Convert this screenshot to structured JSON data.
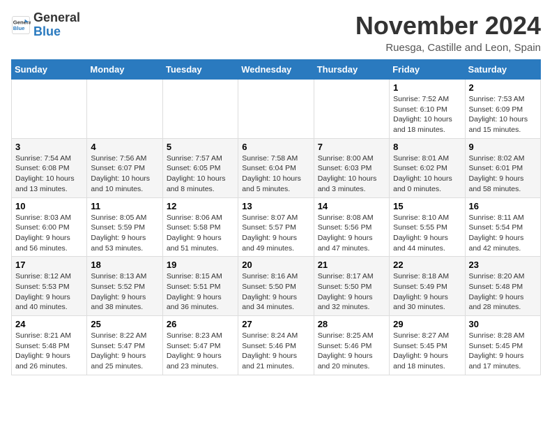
{
  "logo": {
    "line1": "General",
    "line2": "Blue"
  },
  "title": "November 2024",
  "subtitle": "Ruesga, Castille and Leon, Spain",
  "days_of_week": [
    "Sunday",
    "Monday",
    "Tuesday",
    "Wednesday",
    "Thursday",
    "Friday",
    "Saturday"
  ],
  "weeks": [
    [
      {
        "day": "",
        "info": ""
      },
      {
        "day": "",
        "info": ""
      },
      {
        "day": "",
        "info": ""
      },
      {
        "day": "",
        "info": ""
      },
      {
        "day": "",
        "info": ""
      },
      {
        "day": "1",
        "info": "Sunrise: 7:52 AM\nSunset: 6:10 PM\nDaylight: 10 hours and 18 minutes."
      },
      {
        "day": "2",
        "info": "Sunrise: 7:53 AM\nSunset: 6:09 PM\nDaylight: 10 hours and 15 minutes."
      }
    ],
    [
      {
        "day": "3",
        "info": "Sunrise: 7:54 AM\nSunset: 6:08 PM\nDaylight: 10 hours and 13 minutes."
      },
      {
        "day": "4",
        "info": "Sunrise: 7:56 AM\nSunset: 6:07 PM\nDaylight: 10 hours and 10 minutes."
      },
      {
        "day": "5",
        "info": "Sunrise: 7:57 AM\nSunset: 6:05 PM\nDaylight: 10 hours and 8 minutes."
      },
      {
        "day": "6",
        "info": "Sunrise: 7:58 AM\nSunset: 6:04 PM\nDaylight: 10 hours and 5 minutes."
      },
      {
        "day": "7",
        "info": "Sunrise: 8:00 AM\nSunset: 6:03 PM\nDaylight: 10 hours and 3 minutes."
      },
      {
        "day": "8",
        "info": "Sunrise: 8:01 AM\nSunset: 6:02 PM\nDaylight: 10 hours and 0 minutes."
      },
      {
        "day": "9",
        "info": "Sunrise: 8:02 AM\nSunset: 6:01 PM\nDaylight: 9 hours and 58 minutes."
      }
    ],
    [
      {
        "day": "10",
        "info": "Sunrise: 8:03 AM\nSunset: 6:00 PM\nDaylight: 9 hours and 56 minutes."
      },
      {
        "day": "11",
        "info": "Sunrise: 8:05 AM\nSunset: 5:59 PM\nDaylight: 9 hours and 53 minutes."
      },
      {
        "day": "12",
        "info": "Sunrise: 8:06 AM\nSunset: 5:58 PM\nDaylight: 9 hours and 51 minutes."
      },
      {
        "day": "13",
        "info": "Sunrise: 8:07 AM\nSunset: 5:57 PM\nDaylight: 9 hours and 49 minutes."
      },
      {
        "day": "14",
        "info": "Sunrise: 8:08 AM\nSunset: 5:56 PM\nDaylight: 9 hours and 47 minutes."
      },
      {
        "day": "15",
        "info": "Sunrise: 8:10 AM\nSunset: 5:55 PM\nDaylight: 9 hours and 44 minutes."
      },
      {
        "day": "16",
        "info": "Sunrise: 8:11 AM\nSunset: 5:54 PM\nDaylight: 9 hours and 42 minutes."
      }
    ],
    [
      {
        "day": "17",
        "info": "Sunrise: 8:12 AM\nSunset: 5:53 PM\nDaylight: 9 hours and 40 minutes."
      },
      {
        "day": "18",
        "info": "Sunrise: 8:13 AM\nSunset: 5:52 PM\nDaylight: 9 hours and 38 minutes."
      },
      {
        "day": "19",
        "info": "Sunrise: 8:15 AM\nSunset: 5:51 PM\nDaylight: 9 hours and 36 minutes."
      },
      {
        "day": "20",
        "info": "Sunrise: 8:16 AM\nSunset: 5:50 PM\nDaylight: 9 hours and 34 minutes."
      },
      {
        "day": "21",
        "info": "Sunrise: 8:17 AM\nSunset: 5:50 PM\nDaylight: 9 hours and 32 minutes."
      },
      {
        "day": "22",
        "info": "Sunrise: 8:18 AM\nSunset: 5:49 PM\nDaylight: 9 hours and 30 minutes."
      },
      {
        "day": "23",
        "info": "Sunrise: 8:20 AM\nSunset: 5:48 PM\nDaylight: 9 hours and 28 minutes."
      }
    ],
    [
      {
        "day": "24",
        "info": "Sunrise: 8:21 AM\nSunset: 5:48 PM\nDaylight: 9 hours and 26 minutes."
      },
      {
        "day": "25",
        "info": "Sunrise: 8:22 AM\nSunset: 5:47 PM\nDaylight: 9 hours and 25 minutes."
      },
      {
        "day": "26",
        "info": "Sunrise: 8:23 AM\nSunset: 5:47 PM\nDaylight: 9 hours and 23 minutes."
      },
      {
        "day": "27",
        "info": "Sunrise: 8:24 AM\nSunset: 5:46 PM\nDaylight: 9 hours and 21 minutes."
      },
      {
        "day": "28",
        "info": "Sunrise: 8:25 AM\nSunset: 5:46 PM\nDaylight: 9 hours and 20 minutes."
      },
      {
        "day": "29",
        "info": "Sunrise: 8:27 AM\nSunset: 5:45 PM\nDaylight: 9 hours and 18 minutes."
      },
      {
        "day": "30",
        "info": "Sunrise: 8:28 AM\nSunset: 5:45 PM\nDaylight: 9 hours and 17 minutes."
      }
    ]
  ]
}
